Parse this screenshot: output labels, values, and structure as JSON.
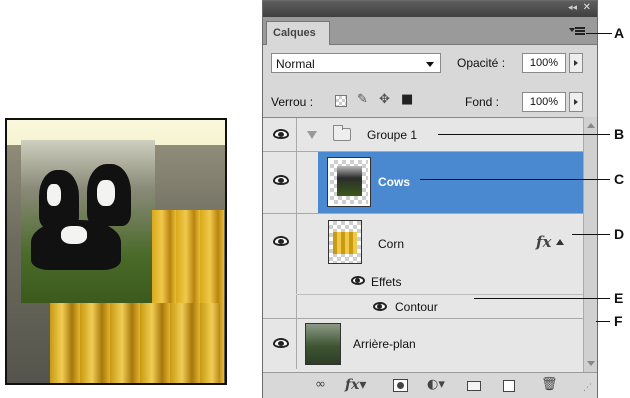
{
  "panel": {
    "tab_label": "Calques",
    "blend_mode": "Normal",
    "opacity_label": "Opacité :",
    "opacity_value": "100%",
    "lock_label": "Verrou :",
    "fill_label": "Fond :",
    "fill_value": "100%",
    "accent_color": "#4a88cf"
  },
  "layers": {
    "group": {
      "name": "Groupe 1",
      "collapsed_icon": "triangle-right"
    },
    "cows": {
      "name": "Cows",
      "selected": true
    },
    "corn": {
      "name": "Corn",
      "fx_label": "fx"
    },
    "effects": {
      "label": "Effets",
      "stroke_label": "Contour"
    },
    "background": {
      "name": "Arrière-plan"
    }
  },
  "bottom_bar": {
    "icons": [
      "link-icon",
      "fx-icon",
      "mask-icon",
      "adjustment-icon",
      "folder-icon",
      "new-layer-icon",
      "trash-icon"
    ]
  },
  "callouts": [
    "A",
    "B",
    "C",
    "D",
    "E",
    "F"
  ]
}
